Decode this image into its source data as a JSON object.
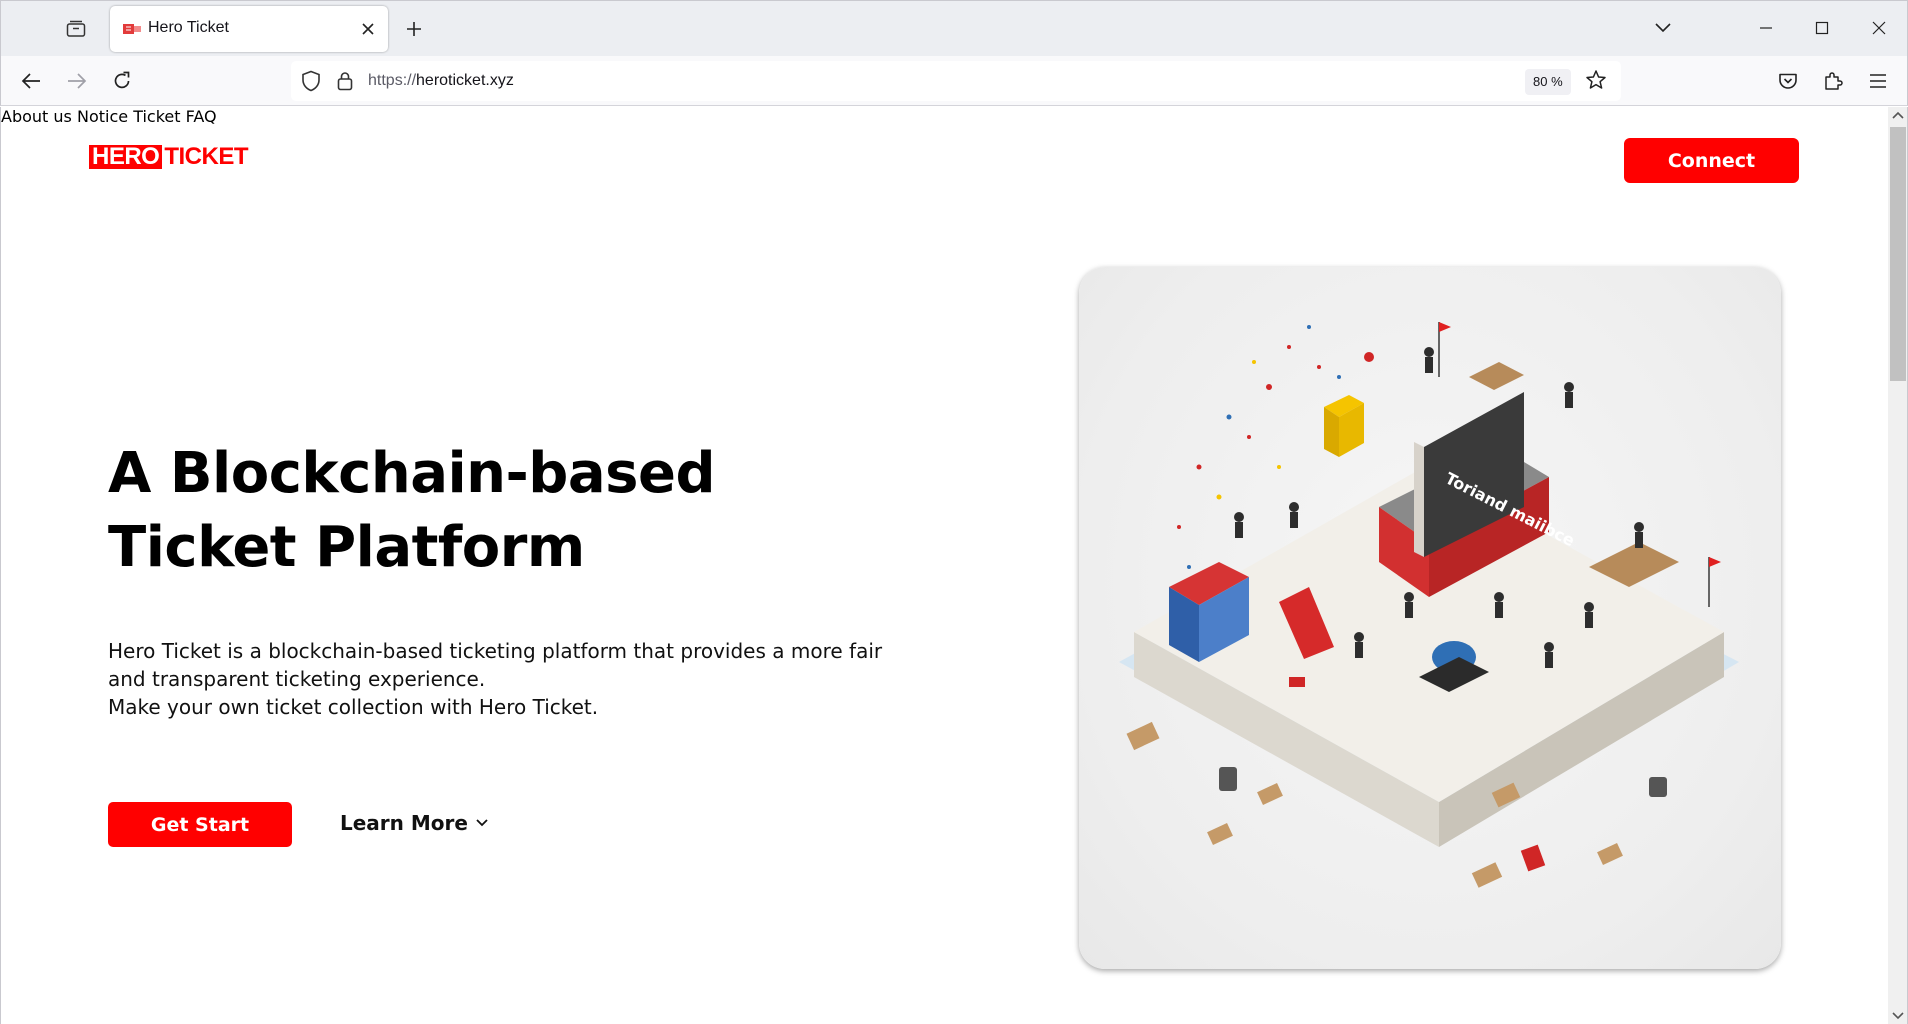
{
  "browser": {
    "tab": {
      "title": "Hero Ticket"
    },
    "url": {
      "scheme": "https://",
      "host": "heroticket.xyz"
    },
    "zoom": "80 %"
  },
  "site": {
    "logo": {
      "hero": "HERO",
      "ticket": "TICKET"
    },
    "nav": {
      "about": "About us",
      "notice": "Notice",
      "ticket": "Ticket",
      "faq": "FAQ"
    },
    "connect_label": "Connect"
  },
  "hero": {
    "title": "A Blockchain-based Ticket Platform",
    "description_line1": "Hero Ticket is a blockchain-based ticketing platform that provides a more fair and transparent ticketing experience.",
    "description_line2": "Make your own ticket collection with Hero Ticket.",
    "get_start_label": "Get Start",
    "learn_more_label": "Learn More",
    "illustration_sign_text": "Toriand maiibce"
  },
  "colors": {
    "brand_red": "#ff0000",
    "text_dark": "#111111"
  },
  "icons": {
    "tab_list": "tab-list-icon",
    "close": "close-icon",
    "new_tab": "plus-icon",
    "back": "arrow-left-icon",
    "forward": "arrow-right-icon",
    "reload": "reload-icon",
    "shield": "shield-icon",
    "lock": "lock-icon",
    "bookmark": "star-icon",
    "pocket": "pocket-icon",
    "extensions": "puzzle-icon",
    "menu": "hamburger-icon",
    "chevron": "chevron-down-icon"
  }
}
